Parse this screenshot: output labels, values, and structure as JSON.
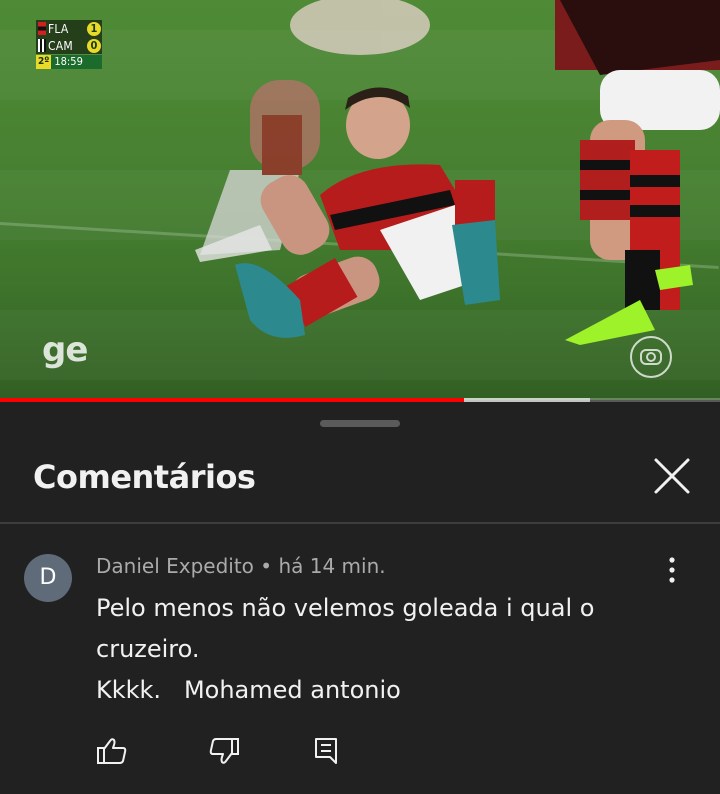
{
  "video": {
    "scoreboard": {
      "home_team": "FLA",
      "home_score": "1",
      "away_team": "CAM",
      "away_score": "0",
      "period": "2º",
      "clock": "18:59"
    },
    "watermark_left": "ge",
    "watermark_right_icon": "globo-logo-icon",
    "progress": {
      "played_fraction": 0.645,
      "buffered_fraction": 0.82,
      "played_color": "#ff0000"
    }
  },
  "comments_panel": {
    "title": "Comentários",
    "close_icon": "close-icon",
    "comment": {
      "avatar_letter": "D",
      "author": "Daniel Expedito",
      "separator": " • ",
      "time": "há 14 min.",
      "lines": [
        "Pelo menos não velemos goleada i qual o",
        "cruzeiro.",
        "Kkkk.   Mohamed antonio"
      ],
      "actions": [
        "like-icon",
        "dislike-icon",
        "reply-icon"
      ],
      "menu_icon": "more-vertical-icon"
    }
  },
  "colors": {
    "sheet_bg": "#212121",
    "text_primary": "#f1f1f1",
    "text_secondary": "#aaaaaa",
    "avatar_bg": "#5f6b78",
    "score_badge": "#e9d928"
  }
}
